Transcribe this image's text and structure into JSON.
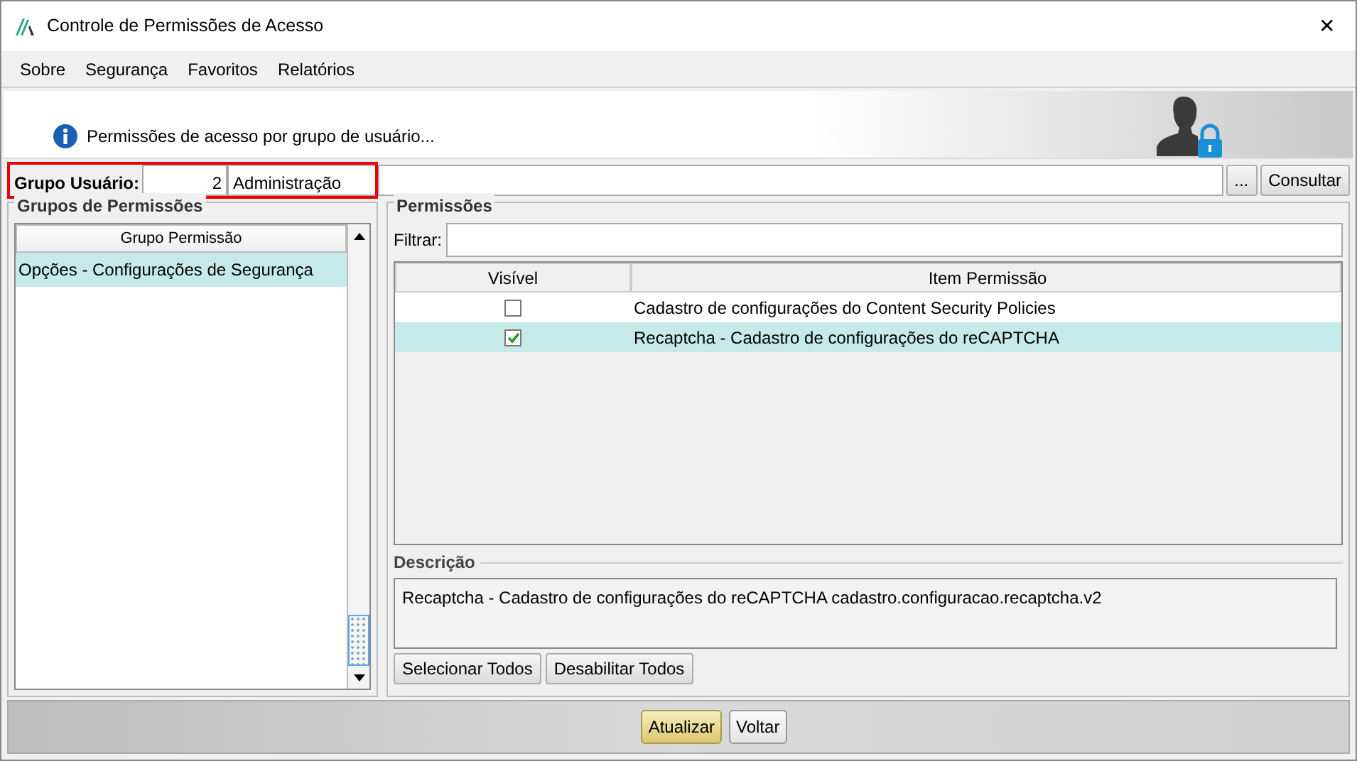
{
  "window": {
    "title": "Controle de Permissões de Acesso",
    "close": "✕"
  },
  "menu": [
    {
      "label": "Sobre"
    },
    {
      "label": "Segurança"
    },
    {
      "label": "Favoritos"
    },
    {
      "label": "Relatórios"
    }
  ],
  "header": {
    "message": "Permissões de acesso por grupo de usuário..."
  },
  "user_group": {
    "label": "Grupo Usuário:",
    "code": "2",
    "name": "Administração",
    "browse_button": "...",
    "search_button": "Consultar"
  },
  "groups_panel": {
    "title": "Grupos de Permissões",
    "column": "Grupo Permissão",
    "rows": [
      {
        "name": "Opções - Configurações de Segurança",
        "selected": true
      }
    ]
  },
  "permissions_panel": {
    "title": "Permissões",
    "filter_label": "Filtrar:",
    "columns": [
      "Visível",
      "Item Permissão"
    ],
    "rows": [
      {
        "visible": false,
        "item": "Cadastro de configurações do Content Security Policies",
        "selected": false
      },
      {
        "visible": true,
        "item": "Recaptcha - Cadastro de configurações do reCAPTCHA",
        "selected": true
      }
    ],
    "description_title": "Descrição",
    "description": "Recaptcha - Cadastro de configurações do reCAPTCHA cadastro.configuracao.recaptcha.v2",
    "buttons": [
      "Selecionar Todos",
      "Desabilitar Todos"
    ]
  },
  "footer_buttons": [
    {
      "label": "Atualizar",
      "default": true
    },
    {
      "label": "Voltar",
      "default": false
    }
  ]
}
